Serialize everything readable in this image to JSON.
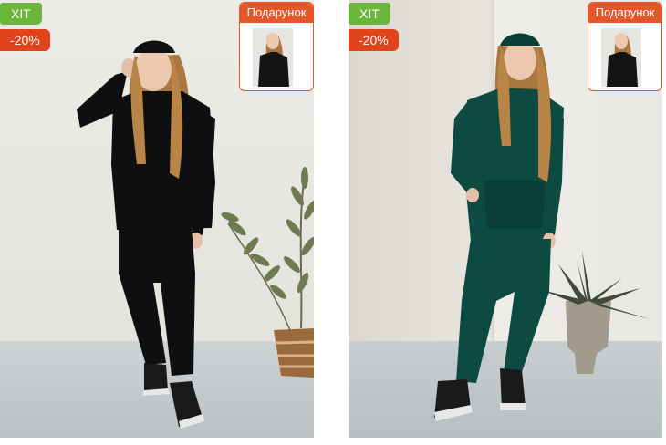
{
  "products": [
    {
      "badge_hit": "ХІТ",
      "badge_discount": "-20%",
      "gift_label": "Подарунок",
      "suit_color": "#0f0f12"
    },
    {
      "badge_hit": "ХІТ",
      "badge_discount": "-20%",
      "gift_label": "Подарунок",
      "suit_color": "#0c4a42"
    }
  ],
  "gift_thumb_color": "#141414"
}
